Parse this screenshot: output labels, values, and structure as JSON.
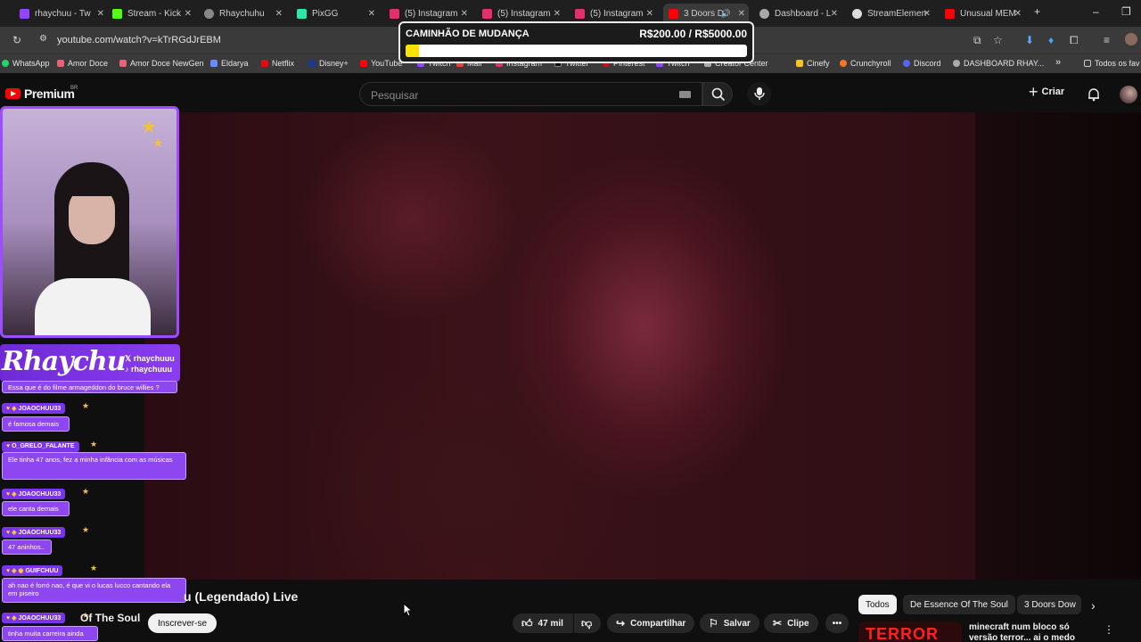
{
  "tabs": [
    {
      "title": "rhaychuu - Tw",
      "color": "#9146ff"
    },
    {
      "title": "Stream - Kick",
      "color": "#53fc18"
    },
    {
      "title": "Rhaychuhu",
      "color": "#cccccc"
    },
    {
      "title": "PixGG",
      "color": "#2ee6a8"
    },
    {
      "title": "(5) Instagram",
      "color": "#e1306c"
    },
    {
      "title": "(5) Instagram",
      "color": "#e1306c"
    },
    {
      "title": "(5) Instagram",
      "color": "#e1306c"
    },
    {
      "title": "3 Doors D",
      "color": "#ff0000"
    },
    {
      "title": "Dashboard - L",
      "color": "#cccccc"
    },
    {
      "title": "StreamElemen",
      "color": "#cccccc"
    },
    {
      "title": "Unusual MEM",
      "color": "#ff0000"
    }
  ],
  "browser": {
    "url": "youtube.com/watch?v=kTrRGdJrEBM"
  },
  "bookmarks": [
    "WhatsApp",
    "Amor Doce",
    "Amor Doce NewGen",
    "Eldarya",
    "Netflix",
    "Disney+",
    "YouTube",
    "Twitch",
    "Mail",
    "Instagram",
    "Twitter",
    "Pinterest",
    "Twitch",
    "Creator Center",
    "Cinefy",
    "Crunchyroll",
    "Discord",
    "DASHBOARD RHAY...",
    "Todos os fav"
  ],
  "youtube": {
    "logo": "Premium",
    "region": "BR",
    "search_placeholder": "Pesquisar",
    "create_label": "Criar",
    "video_title": "u (Legendado) Live",
    "channel": "Of The Soul",
    "subscribe_label": "Inscrever-se",
    "likes": "47 mil",
    "share_label": "Compartilhar",
    "save_label": "Salvar",
    "clip_label": "Clipe",
    "chips": [
      "Todos",
      "De Essence Of The Soul",
      "3 Doors Dow"
    ],
    "rec_title": "minecraft num bloco só versão terror... ai o medo",
    "rec_thumb_text": "TERROR"
  },
  "overlay": {
    "goal_title": "CAMINHÃO DE MUDANÇA",
    "goal_amount": "R$200.00 / R$5000.00",
    "goal_progress": 0.04,
    "brand": "Rhaychu",
    "social1": "rhaychuuu",
    "social2": "rhaychuuu"
  },
  "chat": [
    {
      "user": "",
      "msg": "Essa que é do filme armageddon do bruce willies ?"
    },
    {
      "user": "JOAOCHUU33",
      "msg": "é famosa demais"
    },
    {
      "user": "O_GRELO_FALANTE",
      "msg": "Ele tinha 47 anos, fez a minha infância com as músicas"
    },
    {
      "user": "JOAOCHUU33",
      "msg": "ele canta demais"
    },
    {
      "user": "JOAOCHUU33",
      "msg": "47 aninhos.."
    },
    {
      "user": "GUIFCHUU",
      "msg": "ah nao é forró nao, é que vi o lucas lucco cantando ela em piseiro"
    },
    {
      "user": "JOAOCHUU33",
      "msg": "tinha muita carreira ainda"
    }
  ]
}
